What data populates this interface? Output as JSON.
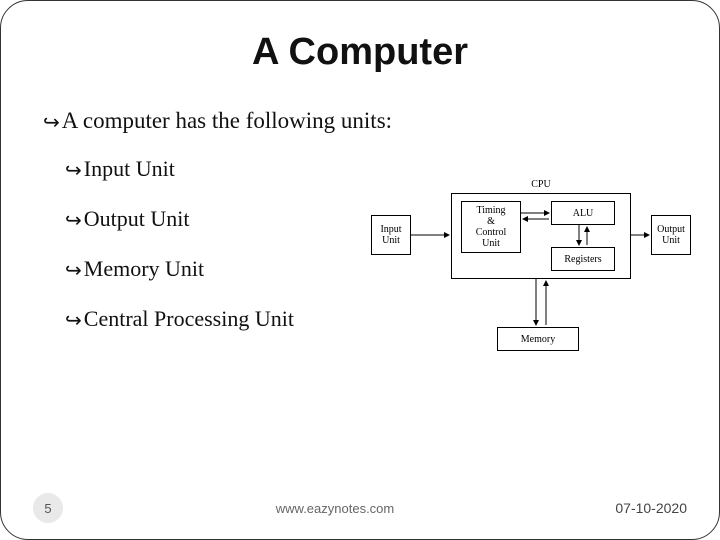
{
  "title": "A Computer",
  "intro": "A computer has the following units:",
  "bullets": {
    "b0": "Input Unit",
    "b1": "Output Unit",
    "b2": "Memory Unit",
    "b3": "Central Processing Unit"
  },
  "diagram": {
    "cpu_label": "CPU",
    "input_unit": "Input\nUnit",
    "output_unit": "Output\nUnit",
    "tcu": "Timing\n&\nControl\nUnit",
    "alu": "ALU",
    "registers": "Registers",
    "memory": "Memory"
  },
  "footer": {
    "slide_number": "5",
    "site": "www.eazynotes.com",
    "date": "07-10-2020"
  },
  "bullet_glyph": "↪"
}
